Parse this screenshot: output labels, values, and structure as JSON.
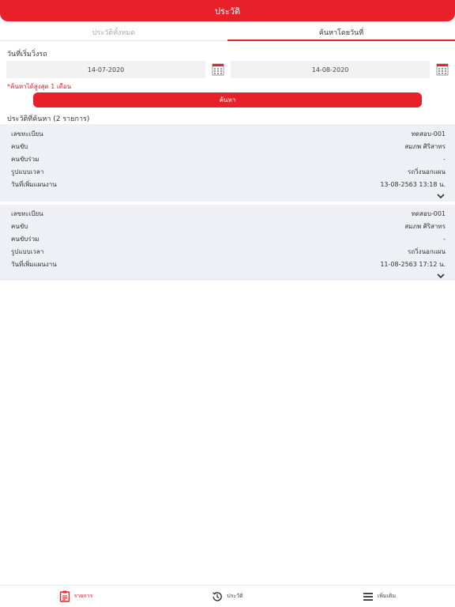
{
  "header": {
    "title": "ประวัติ"
  },
  "tabs": [
    {
      "label": "ประวัติทั้งหมด",
      "active": false
    },
    {
      "label": "ค้นหาโดยวันที่",
      "active": true
    }
  ],
  "search": {
    "section_label": "วันที่เริ่มวิ่งรถ",
    "start_date": "14-07-2020",
    "end_date": "14-08-2020",
    "note": "*ค้นหาได้สูงสุด 1 เดือน",
    "button_label": "ค้นหา"
  },
  "results": {
    "title": "ประวัติที่ค้นหา (2 รายการ)",
    "items": [
      {
        "rows": [
          {
            "label": "เลขทะเบียน",
            "value": "ทดสอบ-001"
          },
          {
            "label": "คนขับ",
            "value": "สมภพ   ศิริสาทร"
          },
          {
            "label": "คนขับร่วม",
            "value": "-"
          },
          {
            "label": "รูปแบบเวลา",
            "value": "รถวิ่งนอกแผน"
          },
          {
            "label": "วันที่เพิ่มแผนงาน",
            "value": "13-08-2563 13:18 น."
          }
        ]
      },
      {
        "rows": [
          {
            "label": "เลขทะเบียน",
            "value": "ทดสอบ-001"
          },
          {
            "label": "คนขับ",
            "value": "สมภพ   ศิริสาทร"
          },
          {
            "label": "คนขับร่วม",
            "value": "-"
          },
          {
            "label": "รูปแบบเวลา",
            "value": "รถวิ่งนอกแผน"
          },
          {
            "label": "วันที่เพิ่มแผนงาน",
            "value": "11-08-2563 17:12 น."
          }
        ]
      }
    ]
  },
  "bottom_nav": [
    {
      "label": "รายการ",
      "icon": "list-clipboard-icon",
      "active": true
    },
    {
      "label": "ประวัติ",
      "icon": "history-icon",
      "active": false
    },
    {
      "label": "เพิ่มเติม",
      "icon": "menu-icon",
      "active": false
    }
  ],
  "colors": {
    "accent": "#e8202a",
    "card_bg": "#eef0f5",
    "input_bg": "#f2f2f2"
  }
}
